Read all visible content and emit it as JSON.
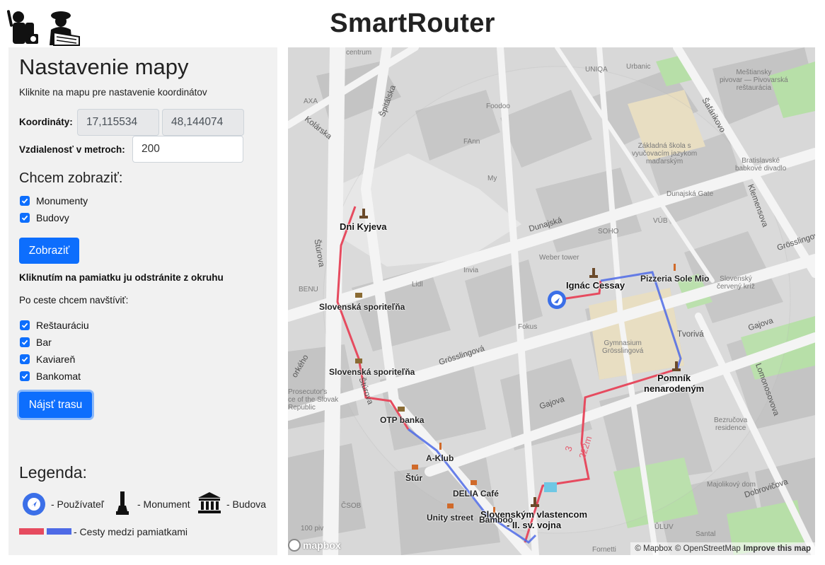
{
  "app": {
    "title": "SmartRouter"
  },
  "panel": {
    "title": "Nastavenie mapy",
    "hint": "Kliknite na mapu pre nastavenie koordinátov",
    "coords_label": "Koordináty:",
    "lon_value": "17,115534",
    "lat_value": "48,144074",
    "distance_label": "Vzdialenosť v metroch:",
    "distance_value": "200",
    "show_heading": "Chcem zobraziť:",
    "show_options": [
      {
        "label": "Monumenty",
        "checked": true
      },
      {
        "label": "Budovy",
        "checked": true
      }
    ],
    "show_button": "Zobraziť",
    "remove_hint": "Kliknutím na pamiatku ju odstránite z okruhu",
    "visit_heading": "Po ceste chcem navštíviť:",
    "visit_options": [
      {
        "label": "Reštauráciu",
        "checked": true
      },
      {
        "label": "Bar",
        "checked": true
      },
      {
        "label": "Kaviareň",
        "checked": true
      },
      {
        "label": "Bankomat",
        "checked": true
      }
    ],
    "find_button": "Nájsť trasu"
  },
  "legend": {
    "title": "Legenda:",
    "user": "- Používateľ",
    "monument": "- Monument",
    "building": "- Budova",
    "paths": "- Cesty medzi pamiatkami",
    "colors": {
      "red": "#e64b5f",
      "blue": "#4e6ae6",
      "user": "#3b6fe8"
    }
  },
  "map": {
    "pois": {
      "dni_kyjeva": "Dni Kyjeva",
      "ignac_cessay": "Ignác Cessay",
      "pizzeria": "Pizzeria Sole Mio",
      "pomnik": "Pomník\nnenarodeným",
      "vlastencom": "Slovenským vlastencom\n- II. sv. vojna",
      "sporitelna1": "Slovenská sporiteľňa",
      "sporitelna2": "Slovenská sporiteľňa",
      "otp": "OTP banka",
      "aklub": "A-Klub",
      "delia": "DELIA Café",
      "unity": "Unity street",
      "bamboo": "Bamboo",
      "stur": "Štúr"
    },
    "streets": {
      "dunajska": "Dunajská",
      "grosslingova": "Grösslingová",
      "gajova": "Gajova",
      "gajova2": "Gajova",
      "sturova": "Štúrova",
      "sturova2": "Štúrova",
      "kolarska": "Kolárska",
      "spitalska": "Špitálska",
      "klemensova": "Klemensova",
      "lomonosovova": "Lomonosovova",
      "dobrovicova": "Dobrovičova",
      "satinskeho": "Šafárikovo",
      "grosslingova2": "Grösslingová",
      "tvorivo": "Tvorivá",
      "orkeho": "orkého"
    },
    "faded": {
      "centrum": "centrum",
      "axa": "AXA",
      "unique": "UNIQA",
      "urbanic": "Urbanic",
      "foodoo": "Foodoo",
      "fann": "FAnn",
      "my": "My",
      "soho": "SOHO",
      "vub": "VÚB",
      "weber": "Weber tower",
      "invia": "Invia",
      "lidl": "Lidl",
      "fokus": "Fokus",
      "benu": "BENU",
      "csob": "ČSOB",
      "ulova": "ŮLUV",
      "santal": "Santal",
      "fornetti": "Fornetti",
      "dunaja": "Dunajská Gate",
      "majolikovy": "Majolikový dom",
      "bezrucova": "Bezručova\nresidence",
      "gymnazium": "Gymnasium\nGrösslingová",
      "zakladna": "Základná škola s\nvyučovacím jazykom\nmaďarským",
      "mestiansky": "Meštiansky\npivovar — Pivovarská\nreštaurácia",
      "bratislavske": "Bratislavské\nbabkové divadlo",
      "cerveny": "Slovenský\nčervený kríž",
      "prosecutor": "Prosecutor's\nce of the Slovak\nRepublic",
      "sto": "100 piv"
    },
    "route_distance": "222m",
    "route_index": "3",
    "mapbox_logo": "mapbox",
    "attrib_mapbox": "© Mapbox",
    "attrib_osm": "© OpenStreetMap",
    "attrib_improve": "Improve this map"
  }
}
